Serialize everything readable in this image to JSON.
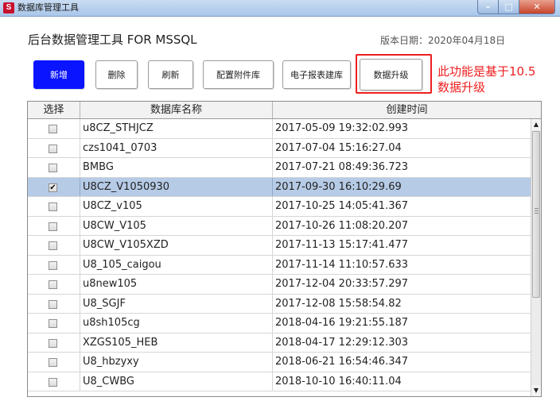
{
  "window": {
    "title": "数据库管理工具",
    "icon_letter": "S",
    "controls": {
      "minimize": "–",
      "maximize": "□",
      "close": "✕"
    }
  },
  "header": {
    "app_title": "后台数据管理工具 FOR MSSQL",
    "version_label": "版本日期：2020年04月18日"
  },
  "toolbar": {
    "add": "新增",
    "delete": "删除",
    "refresh": "刷新",
    "config_attachment": "配置附件库",
    "report_db": "电子报表建库",
    "upgrade": "数据升级"
  },
  "annotation": {
    "line1": "此功能是基于10.5",
    "line2": "数据升级"
  },
  "table": {
    "columns": [
      "选择",
      "数据库名称",
      "创建时间"
    ],
    "rows": [
      {
        "checked": false,
        "name": "u8CZ_STHJCZ",
        "created": "2017-05-09 19:32:02.993"
      },
      {
        "checked": false,
        "name": "czs1041_0703",
        "created": "2017-07-04 15:16:27.04"
      },
      {
        "checked": false,
        "name": "BMBG",
        "created": "2017-07-21 08:49:36.723"
      },
      {
        "checked": true,
        "name": "U8CZ_V1050930",
        "created": "2017-09-30 16:10:29.69"
      },
      {
        "checked": false,
        "name": "U8CZ_v105",
        "created": "2017-10-25 14:05:41.367"
      },
      {
        "checked": false,
        "name": "U8CW_V105",
        "created": "2017-10-26 11:08:20.207"
      },
      {
        "checked": false,
        "name": "U8CW_V105XZD",
        "created": "2017-11-13 15:17:41.477"
      },
      {
        "checked": false,
        "name": "U8_105_caigou",
        "created": "2017-11-14 11:10:57.633"
      },
      {
        "checked": false,
        "name": "u8new105",
        "created": "2017-12-04 20:33:57.297"
      },
      {
        "checked": false,
        "name": "U8_SGJF",
        "created": "2017-12-08 15:58:54.82"
      },
      {
        "checked": false,
        "name": "u8sh105cg",
        "created": "2018-04-16 19:21:55.187"
      },
      {
        "checked": false,
        "name": "XZGS105_HEB",
        "created": "2018-04-17 12:29:12.303"
      },
      {
        "checked": false,
        "name": "U8_hbzyxy",
        "created": "2018-06-21 16:54:46.347"
      },
      {
        "checked": false,
        "name": "U8_CWBG",
        "created": "2018-10-10 16:40:11.04"
      }
    ]
  },
  "scrollbar": {
    "up_arrow": "▲",
    "down_arrow": "▼"
  },
  "colors": {
    "primary_button": "#0a14ff",
    "annotation_red": "#ee1f1f",
    "selected_row": "#b6cbe6"
  }
}
